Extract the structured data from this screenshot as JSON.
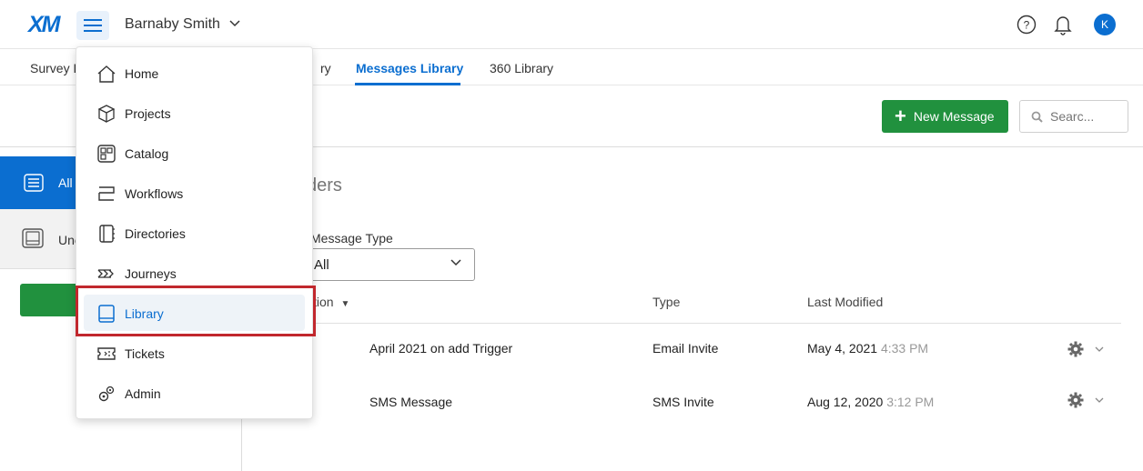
{
  "app": {
    "logo": "XM",
    "user_name": "Barnaby Smith",
    "avatar_initial": "K"
  },
  "tabs": [
    {
      "label": "Survey L",
      "active": false
    },
    {
      "label": "ry",
      "active": false
    },
    {
      "label": "Messages Library",
      "active": true
    },
    {
      "label": "360 Library",
      "active": false
    }
  ],
  "toolbar": {
    "new_label": "New Message",
    "search_placeholder": "Searc..."
  },
  "folders": {
    "all_label": "All",
    "unc_label": "Unc"
  },
  "main": {
    "title": "ders",
    "filter_label": "Message Type",
    "filter_value": "All",
    "columns": {
      "description": "tion",
      "type": "Type",
      "modified": "Last Modified"
    },
    "rows": [
      {
        "name": "April 2021 on add Trigger",
        "type": "Email Invite",
        "date": "May 4, 2021",
        "time": "4:33 PM"
      },
      {
        "name": "SMS Message",
        "type": "SMS Invite",
        "date": "Aug 12, 2020",
        "time": "3:12 PM"
      }
    ]
  },
  "menu": {
    "items": [
      {
        "label": "Home",
        "icon": "home-icon"
      },
      {
        "label": "Projects",
        "icon": "projects-icon"
      },
      {
        "label": "Catalog",
        "icon": "catalog-icon"
      },
      {
        "label": "Workflows",
        "icon": "workflows-icon"
      },
      {
        "label": "Directories",
        "icon": "directories-icon"
      },
      {
        "label": "Journeys",
        "icon": "journeys-icon"
      },
      {
        "label": "Library",
        "icon": "library-icon",
        "selected": true
      },
      {
        "label": "Tickets",
        "icon": "tickets-icon"
      },
      {
        "label": "Admin",
        "icon": "admin-icon"
      }
    ]
  },
  "colors": {
    "accent": "#0b6ed0",
    "green": "#21913e",
    "highlight": "#c1272d"
  }
}
